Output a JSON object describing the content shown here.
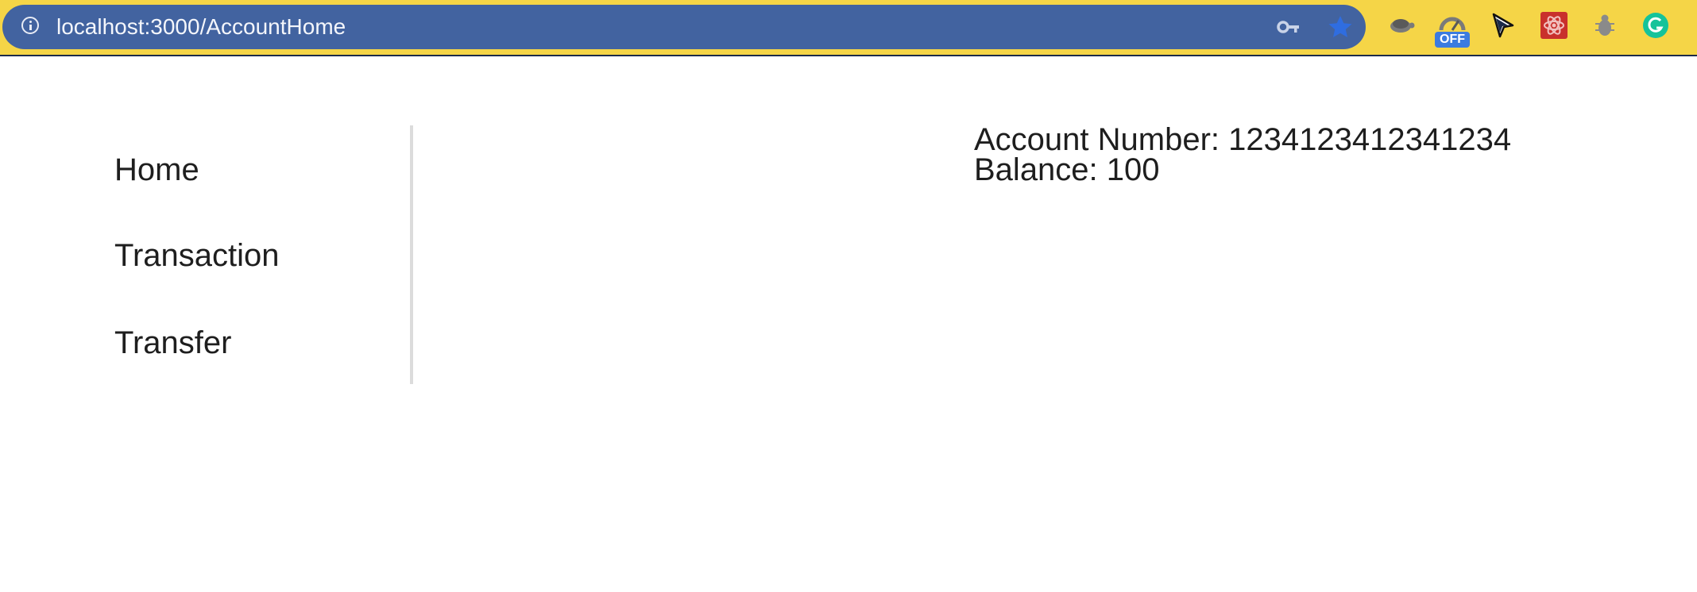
{
  "browser": {
    "url": "localhost:3000/AccountHome",
    "extension_badge": "OFF"
  },
  "icons": {
    "site_info": "info-icon",
    "saved_password": "key-icon",
    "bookmark": "star-icon",
    "extensions": [
      "turtle-icon",
      "speedometer-off-icon",
      "cursor-icon",
      "react-devtools-icon",
      "bug-icon",
      "grammarly-icon"
    ]
  },
  "colors": {
    "browser_frame": "#f5d547",
    "omnibox": "#4263a0",
    "text": "#1e1e1e",
    "sidebar_divider": "#dcdcdc"
  },
  "sidebar": {
    "items": [
      {
        "label": "Home"
      },
      {
        "label": "Transaction"
      },
      {
        "label": "Transfer"
      }
    ]
  },
  "account": {
    "number_line": "Account Number: 1234123412341234",
    "balance_line": "Balance: 100"
  }
}
